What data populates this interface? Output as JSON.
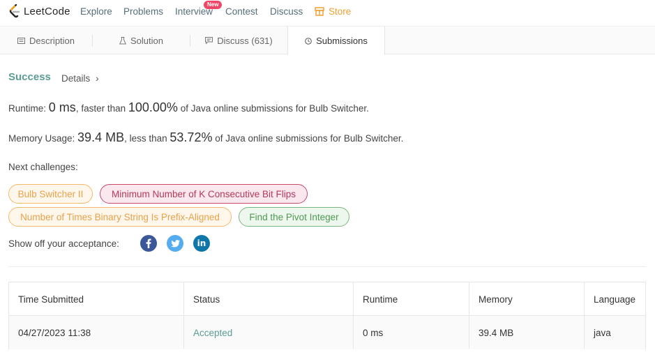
{
  "nav": {
    "logo_text": "LeetCode",
    "links": [
      "Explore",
      "Problems",
      "Interview",
      "Contest",
      "Discuss"
    ],
    "new_badge": "New",
    "store": "Store"
  },
  "tabs": [
    {
      "label": "Description",
      "icon": "description-icon"
    },
    {
      "label": "Solution",
      "icon": "flask-icon"
    },
    {
      "label": "Discuss (631)",
      "icon": "comment-icon"
    },
    {
      "label": "Submissions",
      "icon": "clock-icon",
      "active": true
    }
  ],
  "result": {
    "status": "Success",
    "details": "Details"
  },
  "runtime": {
    "label": "Runtime:",
    "value": "0 ms",
    "mid": ", faster than",
    "percent": "100.00%",
    "tail": "of Java online submissions for Bulb Switcher."
  },
  "memory": {
    "label": "Memory Usage:",
    "value": "39.4 MB",
    "mid": ", less than",
    "percent": "53.72%",
    "tail": "of Java online submissions for Bulb Switcher."
  },
  "next_challenges": {
    "label": "Next challenges:",
    "items": [
      "Bulb Switcher II",
      "Minimum Number of K Consecutive Bit Flips",
      "Number of Times Binary String Is Prefix-Aligned",
      "Find the Pivot Integer"
    ]
  },
  "share": {
    "label": "Show off your acceptance:",
    "icons": [
      "facebook-icon",
      "twitter-icon",
      "linkedin-icon"
    ]
  },
  "table": {
    "headers": [
      "Time Submitted",
      "Status",
      "Runtime",
      "Memory",
      "Language"
    ],
    "rows": [
      [
        "04/27/2023 11:38",
        "Accepted",
        "0 ms",
        "39.4 MB",
        "java"
      ]
    ]
  },
  "colors": {
    "success": "#5c9c95",
    "store": "#f0a035",
    "badge": "#ef4767",
    "facebook": "#3b5998",
    "twitter": "#55acee",
    "linkedin": "#0e76a8"
  }
}
